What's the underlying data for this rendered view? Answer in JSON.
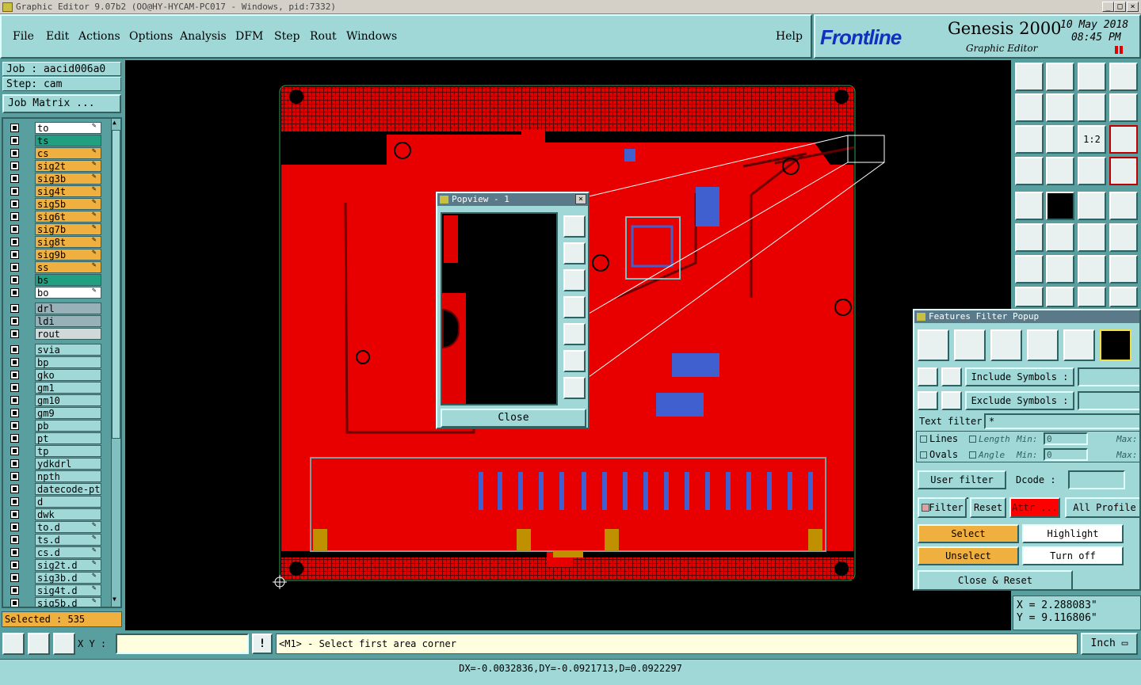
{
  "window": {
    "title": "Graphic Editor 9.07b2 (OO@HY-HYCAM-PC017 - Windows, pid:7332)",
    "min": "_",
    "max": "□",
    "close": "×"
  },
  "menu": [
    "File",
    "Edit",
    "Actions",
    "Options",
    "Analysis",
    "DFM",
    "Step",
    "Rout",
    "Windows"
  ],
  "help": "Help",
  "brand": {
    "logo": "Frontline",
    "product": "Genesis 2000",
    "sub": "Graphic Editor",
    "date": "10 May 2018",
    "time": "08:45 PM"
  },
  "job": {
    "job_label": "Job : aacid006a0",
    "step_label": "Step: cam",
    "matrix": "Job Matrix ..."
  },
  "layers_board": [
    {
      "name": "to",
      "color": "#ffffff",
      "flag": "✎"
    },
    {
      "name": "ts",
      "color": "#20a080",
      "flag": ""
    },
    {
      "name": "cs",
      "color": "#f0b040",
      "flag": "✎"
    },
    {
      "name": "sig2t",
      "color": "#f0b040",
      "flag": "✎"
    },
    {
      "name": "sig3b",
      "color": "#f0b040",
      "flag": "✎"
    },
    {
      "name": "sig4t",
      "color": "#f0b040",
      "flag": "✎"
    },
    {
      "name": "sig5b",
      "color": "#f0b040",
      "flag": "✎"
    },
    {
      "name": "sig6t",
      "color": "#f0b040",
      "flag": "✎"
    },
    {
      "name": "sig7b",
      "color": "#f0b040",
      "flag": "✎"
    },
    {
      "name": "sig8t",
      "color": "#f0b040",
      "flag": "✎"
    },
    {
      "name": "sig9b",
      "color": "#f0b040",
      "flag": "✎"
    },
    {
      "name": "ss",
      "color": "#f0b040",
      "flag": "✎"
    },
    {
      "name": "bs",
      "color": "#20a080",
      "flag": ""
    },
    {
      "name": "bo",
      "color": "#ffffff",
      "flag": "✎"
    }
  ],
  "layers_drill": [
    {
      "name": "drl",
      "color": "#98b0b8",
      "flag": ""
    },
    {
      "name": "ldi",
      "color": "#98b0b8",
      "flag": ""
    },
    {
      "name": "rout",
      "color": "#d0d8d8",
      "flag": ""
    }
  ],
  "layers_misc": [
    {
      "name": "svia",
      "color": "#a0d8d8",
      "flag": ""
    },
    {
      "name": "bp",
      "color": "#a0d8d8",
      "flag": ""
    },
    {
      "name": "gko",
      "color": "#a0d8d8",
      "flag": ""
    },
    {
      "name": "gm1",
      "color": "#a0d8d8",
      "flag": ""
    },
    {
      "name": "gm10",
      "color": "#a0d8d8",
      "flag": ""
    },
    {
      "name": "gm9",
      "color": "#a0d8d8",
      "flag": ""
    },
    {
      "name": "pb",
      "color": "#a0d8d8",
      "flag": ""
    },
    {
      "name": "pt",
      "color": "#a0d8d8",
      "flag": ""
    },
    {
      "name": "tp",
      "color": "#a0d8d8",
      "flag": ""
    },
    {
      "name": "ydkdrl",
      "color": "#a0d8d8",
      "flag": ""
    },
    {
      "name": "npth",
      "color": "#a0d8d8",
      "flag": ""
    },
    {
      "name": "datecode-pt",
      "color": "#a0d8d8",
      "flag": ""
    },
    {
      "name": "d",
      "color": "#a0d8d8",
      "flag": ""
    },
    {
      "name": "dwk",
      "color": "#a0d8d8",
      "flag": ""
    },
    {
      "name": "to.d",
      "color": "#a0d8d8",
      "flag": "✎"
    },
    {
      "name": "ts.d",
      "color": "#a0d8d8",
      "flag": "✎"
    },
    {
      "name": "cs.d",
      "color": "#a0d8d8",
      "flag": "✎"
    },
    {
      "name": "sig2t.d",
      "color": "#a0d8d8",
      "flag": "✎"
    },
    {
      "name": "sig3b.d",
      "color": "#a0d8d8",
      "flag": "✎"
    },
    {
      "name": "sig4t.d",
      "color": "#a0d8d8",
      "flag": "✎"
    },
    {
      "name": "sig5b.d",
      "color": "#a0d8d8",
      "flag": "✎"
    }
  ],
  "selected": "Selected : 535",
  "popview": {
    "title": "Popview - 1",
    "close": "Close"
  },
  "filter": {
    "title": "Features Filter Popup",
    "include": "Include Symbols :",
    "exclude": "Exclude Symbols :",
    "text_filter": "Text filter",
    "text_value": "*",
    "lines": "Lines",
    "ovals": "Ovals",
    "length": "Length",
    "angle": "Angle",
    "min": "Min:",
    "max": "Max:",
    "min_val": "0",
    "user_filter": "User filter ...",
    "dcode": "Dcode :",
    "filter_btn": "Filter",
    "reset": "Reset",
    "attr": "Attr ...",
    "all_profile": "All Profile",
    "select": "Select",
    "highlight": "Highlight",
    "unselect": "Unselect",
    "turn_off": "Turn off",
    "close_reset": "Close & Reset"
  },
  "coords": {
    "x": "X  =  2.288083\"",
    "y": "Y  =  9.116806\""
  },
  "status": {
    "xy_label": "X Y :",
    "message": "<M1> - Select first area corner",
    "units": "Inch"
  },
  "measure": "DX=-0.0032836,DY=-0.0921713,D=0.0922297"
}
